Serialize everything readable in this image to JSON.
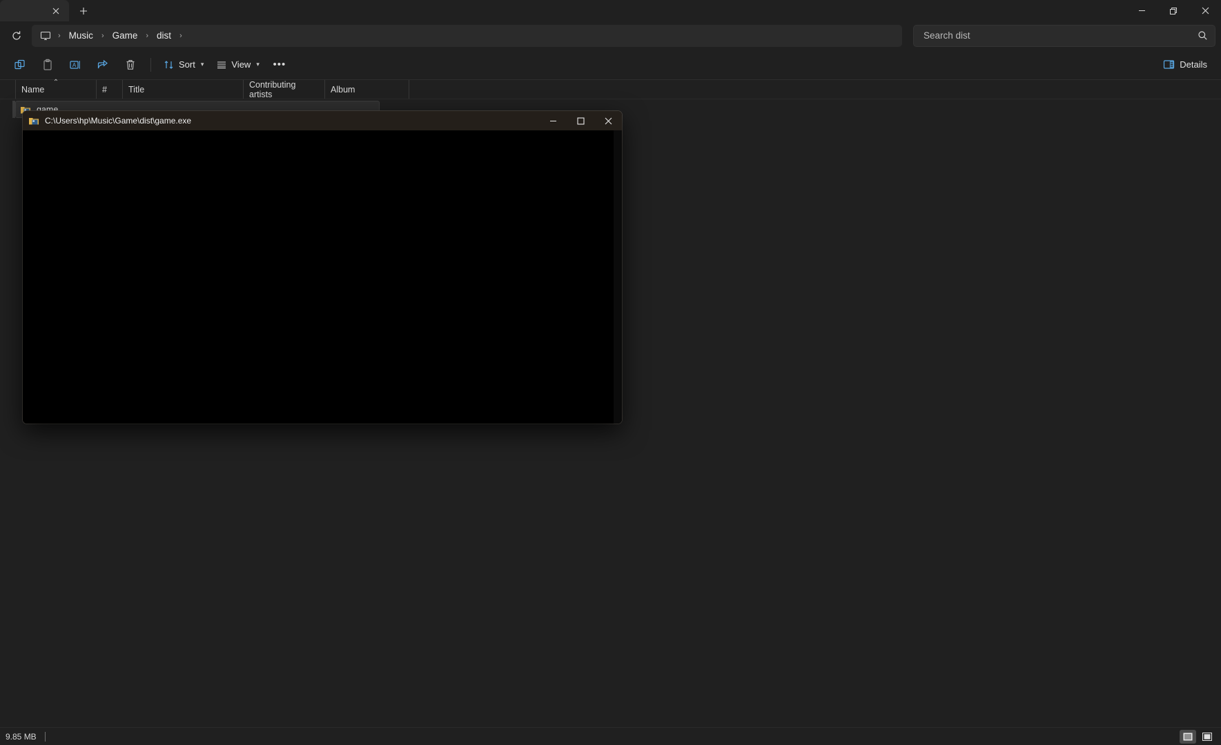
{
  "window": {
    "tab": {
      "title": "",
      "close_label": "✕"
    },
    "new_tab_label": "+",
    "controls": {
      "minimize": "minimize-icon",
      "restore": "restore-icon",
      "close": "close-icon"
    }
  },
  "address": {
    "refresh_label": "refresh-icon",
    "root_icon": "this-pc-icon",
    "breadcrumbs": [
      "Music",
      "Game",
      "dist"
    ],
    "separator": "›",
    "trailing_separator": "›"
  },
  "search": {
    "placeholder": "Search dist",
    "value": "",
    "icon": "search-icon"
  },
  "commandbar": {
    "items": [
      {
        "name": "copy-button",
        "icon": "copy-icon",
        "label": ""
      },
      {
        "name": "paste-button",
        "icon": "paste-icon",
        "label": ""
      },
      {
        "name": "rename-button",
        "icon": "rename-icon",
        "label": ""
      },
      {
        "name": "share-button",
        "icon": "share-icon",
        "label": ""
      },
      {
        "name": "delete-button",
        "icon": "trash-icon",
        "label": ""
      }
    ],
    "sort_label": "Sort",
    "view_label": "View",
    "more_label": "•••",
    "details_label": "Details"
  },
  "columns": [
    {
      "label": "Name",
      "sorted": "ascending",
      "sort_glyph": "⌃"
    },
    {
      "label": "#",
      "sorted": "",
      "sort_glyph": ""
    },
    {
      "label": "Title",
      "sorted": "",
      "sort_glyph": ""
    },
    {
      "label": "Contributing artists",
      "sorted": "",
      "sort_glyph": ""
    },
    {
      "label": "Album",
      "sorted": "",
      "sort_glyph": ""
    }
  ],
  "files": [
    {
      "name": "game",
      "icon": "exe-file-icon",
      "selected": true,
      "number": "",
      "title": "",
      "artists": "",
      "album": ""
    }
  ],
  "statusbar": {
    "size": "9.85 MB",
    "view_details_icon": "details-view-icon",
    "view_large_icons_icon": "large-icons-view-icon",
    "active_view": "details-view-icon"
  },
  "console": {
    "title": "C:\\Users\\hp\\Music\\Game\\dist\\game.exe",
    "icon": "app-window-icon",
    "minimize_label": "minimize-icon",
    "maximize_label": "maximize-icon",
    "close_label": "close-icon",
    "content": "",
    "caret_visible": true
  },
  "colors": {
    "window_bg": "#202020",
    "tab_bg": "#2b2b2b",
    "field_bg": "#2b2b2b",
    "accent_icon": "#5aa9e6",
    "console_bg": "#000000",
    "console_title_bg": "#241f1a",
    "selection_bg": "#2f2f2f"
  }
}
